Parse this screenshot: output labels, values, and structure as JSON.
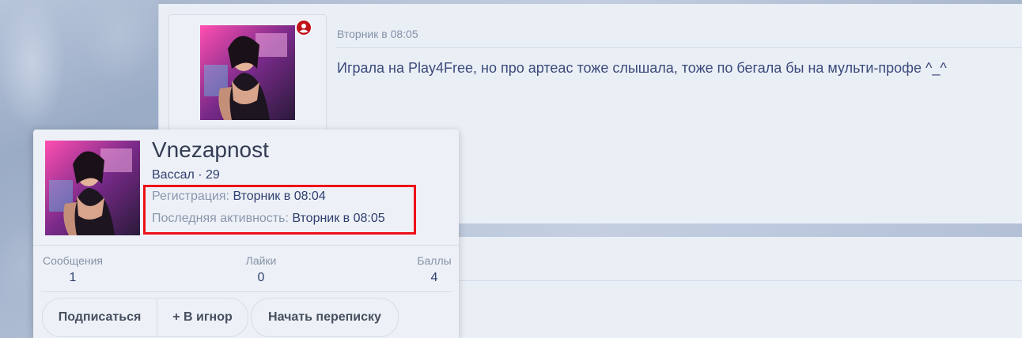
{
  "post": {
    "date": "Вторник в 08:05",
    "message": "Играла на Play4Free, но про артеас тоже слышала, тоже по бегала бы на мульти-профе ^_^"
  },
  "member_card": {
    "username": "Vnezapnost",
    "user_title": "Вассал · 29",
    "registration_label": "Регистрация:",
    "registration_value": "Вторник в 08:04",
    "last_activity_label": "Последняя активность:",
    "last_activity_value": "Вторник в 08:05",
    "stats": [
      {
        "label": "Сообщения",
        "value": "1"
      },
      {
        "label": "Лайки",
        "value": "0"
      },
      {
        "label": "Баллы",
        "value": "4"
      }
    ],
    "buttons": {
      "follow": "Подписаться",
      "ignore": "+ В игнор",
      "start_conversation": "Начать переписку"
    }
  },
  "icons": {
    "online_badge": "user-circle-icon",
    "badge_color": "#c0121a"
  },
  "colors": {
    "highlight_border": "#ee0f16",
    "text_primary": "#2f3e6e",
    "text_muted": "#8592a6"
  }
}
